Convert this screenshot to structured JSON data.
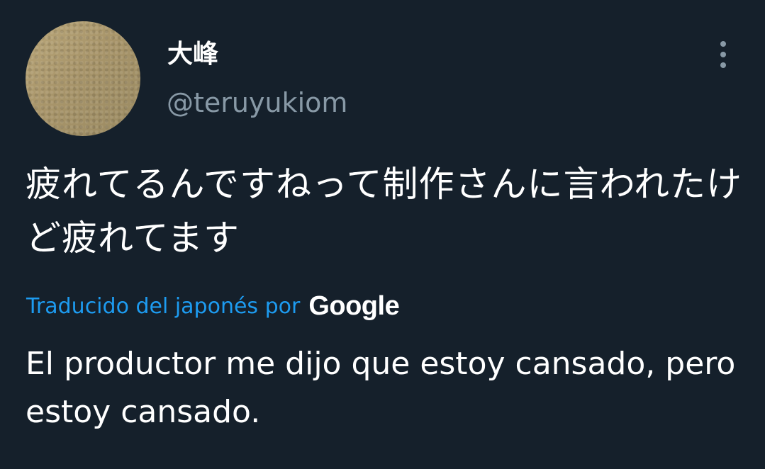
{
  "tweet": {
    "author": {
      "display_name": "大峰",
      "handle": "@teruyukiom"
    },
    "text": "疲れてるんですねって制作さんに言われたけど疲れてます",
    "translation": {
      "label": "Traducido del japonés por",
      "provider": "Google",
      "text": "El productor me dijo que estoy cansado, pero estoy cansado."
    },
    "more_icon": "more-vertical-icon"
  },
  "colors": {
    "background": "#15202b",
    "primary_text": "#ffffff",
    "secondary_text": "#8899a6",
    "link": "#1d9bf0"
  }
}
